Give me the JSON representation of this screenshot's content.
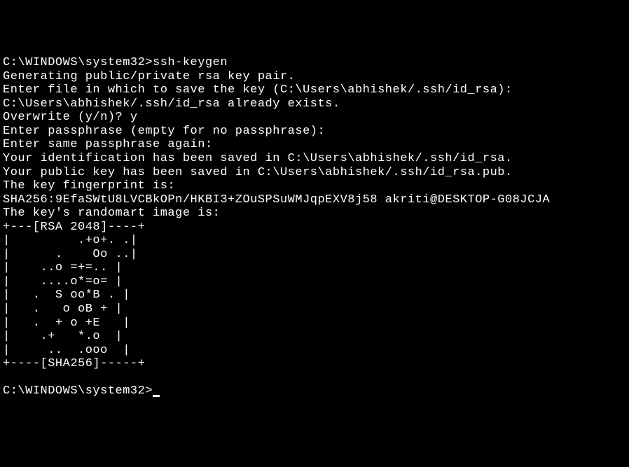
{
  "terminal": {
    "lines": [
      "C:\\WINDOWS\\system32>ssh-keygen",
      "Generating public/private rsa key pair.",
      "Enter file in which to save the key (C:\\Users\\abhishek/.ssh/id_rsa):",
      "C:\\Users\\abhishek/.ssh/id_rsa already exists.",
      "Overwrite (y/n)? y",
      "Enter passphrase (empty for no passphrase):",
      "Enter same passphrase again:",
      "Your identification has been saved in C:\\Users\\abhishek/.ssh/id_rsa.",
      "Your public key has been saved in C:\\Users\\abhishek/.ssh/id_rsa.pub.",
      "The key fingerprint is:",
      "SHA256:9EfaSWtU8LVCBkOPn/HKBI3+ZOuSPSuWMJqpEXV8j58 akriti@DESKTOP-G08JCJA",
      "The key's randomart image is:",
      "+---[RSA 2048]----+",
      "|         .+o+. .|",
      "|      .    Oo ..|",
      "|    ..o =+=.. |",
      "|    ....o*=o= |",
      "|   .  S oo*B . |",
      "|   .   o oB + |",
      "|   .  + o +E   |",
      "|    .+   *.o  |",
      "|     ..  .ooo  |",
      "+----[SHA256]-----+",
      "",
      "C:\\WINDOWS\\system32>"
    ]
  }
}
